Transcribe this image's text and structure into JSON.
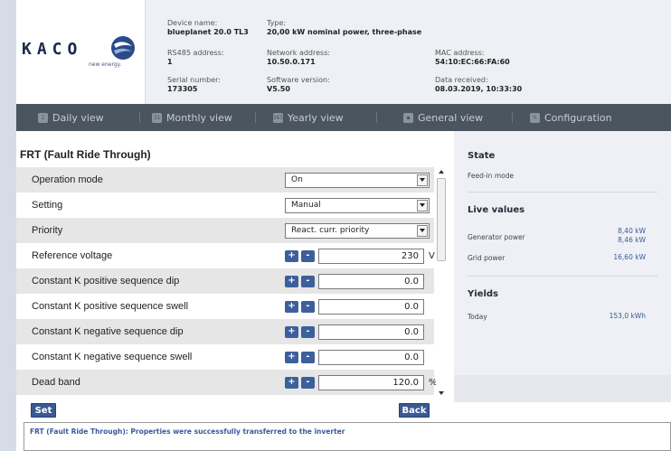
{
  "brand": {
    "logo_text": "KACO",
    "tagline": "new energy."
  },
  "device_info": {
    "device_name_label": "Device name:",
    "device_name": "blueplanet 20.0 TL3",
    "type_label": "Type:",
    "type": "20,00 kW nominal power, three-phase",
    "rs485_label": "RS485 address:",
    "rs485": "1",
    "network_label": "Network address:",
    "network": "10.50.0.171",
    "mac_label": "MAC address:",
    "mac": "54:10:EC:66:FA:60",
    "serial_label": "Serial number:",
    "serial": "173305",
    "software_label": "Software version:",
    "software": "V5.50",
    "data_received_label": "Data received:",
    "data_received": "08.03.2019, 10:33:30"
  },
  "nav": {
    "items": [
      {
        "label": "Daily view",
        "icon": "calendar-day-icon",
        "glyph": "1"
      },
      {
        "label": "Monthly view",
        "icon": "calendar-month-icon",
        "glyph": "31"
      },
      {
        "label": "Yearly view",
        "icon": "calendar-year-icon",
        "glyph": "365"
      },
      {
        "label": "General view",
        "icon": "overview-icon",
        "glyph": "▪"
      },
      {
        "label": "Configuration",
        "icon": "wrench-icon",
        "glyph": "✎"
      }
    ]
  },
  "page": {
    "title": "FRT (Fault Ride Through)"
  },
  "form": {
    "rows": [
      {
        "label": "Operation mode",
        "kind": "select",
        "value": "On"
      },
      {
        "label": "Setting",
        "kind": "select",
        "value": "Manual"
      },
      {
        "label": "Priority",
        "kind": "select",
        "value": "React. curr. priority"
      },
      {
        "label": "Reference voltage",
        "kind": "number",
        "value": "230",
        "unit": "V"
      },
      {
        "label": "Constant K positive sequence dip",
        "kind": "number",
        "value": "0.0",
        "unit": ""
      },
      {
        "label": "Constant K positive sequence swell",
        "kind": "number",
        "value": "0.0",
        "unit": ""
      },
      {
        "label": "Constant K negative sequence dip",
        "kind": "number",
        "value": "0.0",
        "unit": ""
      },
      {
        "label": "Constant K negative sequence swell",
        "kind": "number",
        "value": "0.0",
        "unit": ""
      },
      {
        "label": "Dead band",
        "kind": "number",
        "value": "120.0",
        "unit": "%"
      }
    ],
    "plus_label": "+",
    "minus_label": "-"
  },
  "actions": {
    "set_label": "Set",
    "back_label": "Back"
  },
  "side": {
    "state_heading": "State",
    "state_value": "Feed-in mode",
    "live_heading": "Live values",
    "generator_label": "Generator power",
    "generator_value_1": "8,40 kW",
    "generator_value_2": "8,46 kW",
    "grid_label": "Grid power",
    "grid_value": "16,60 kW",
    "yields_heading": "Yields",
    "today_label": "Today",
    "today_value": "153,0 kWh"
  },
  "message": {
    "text": "FRT (Fault Ride Through): Properties were successfully transferred to the inverter"
  },
  "colors": {
    "accent": "#3d5f9c",
    "nav_bg": "#4a5560",
    "panel_bg": "#eef0f5",
    "row_shade": "#e6e6e6"
  }
}
